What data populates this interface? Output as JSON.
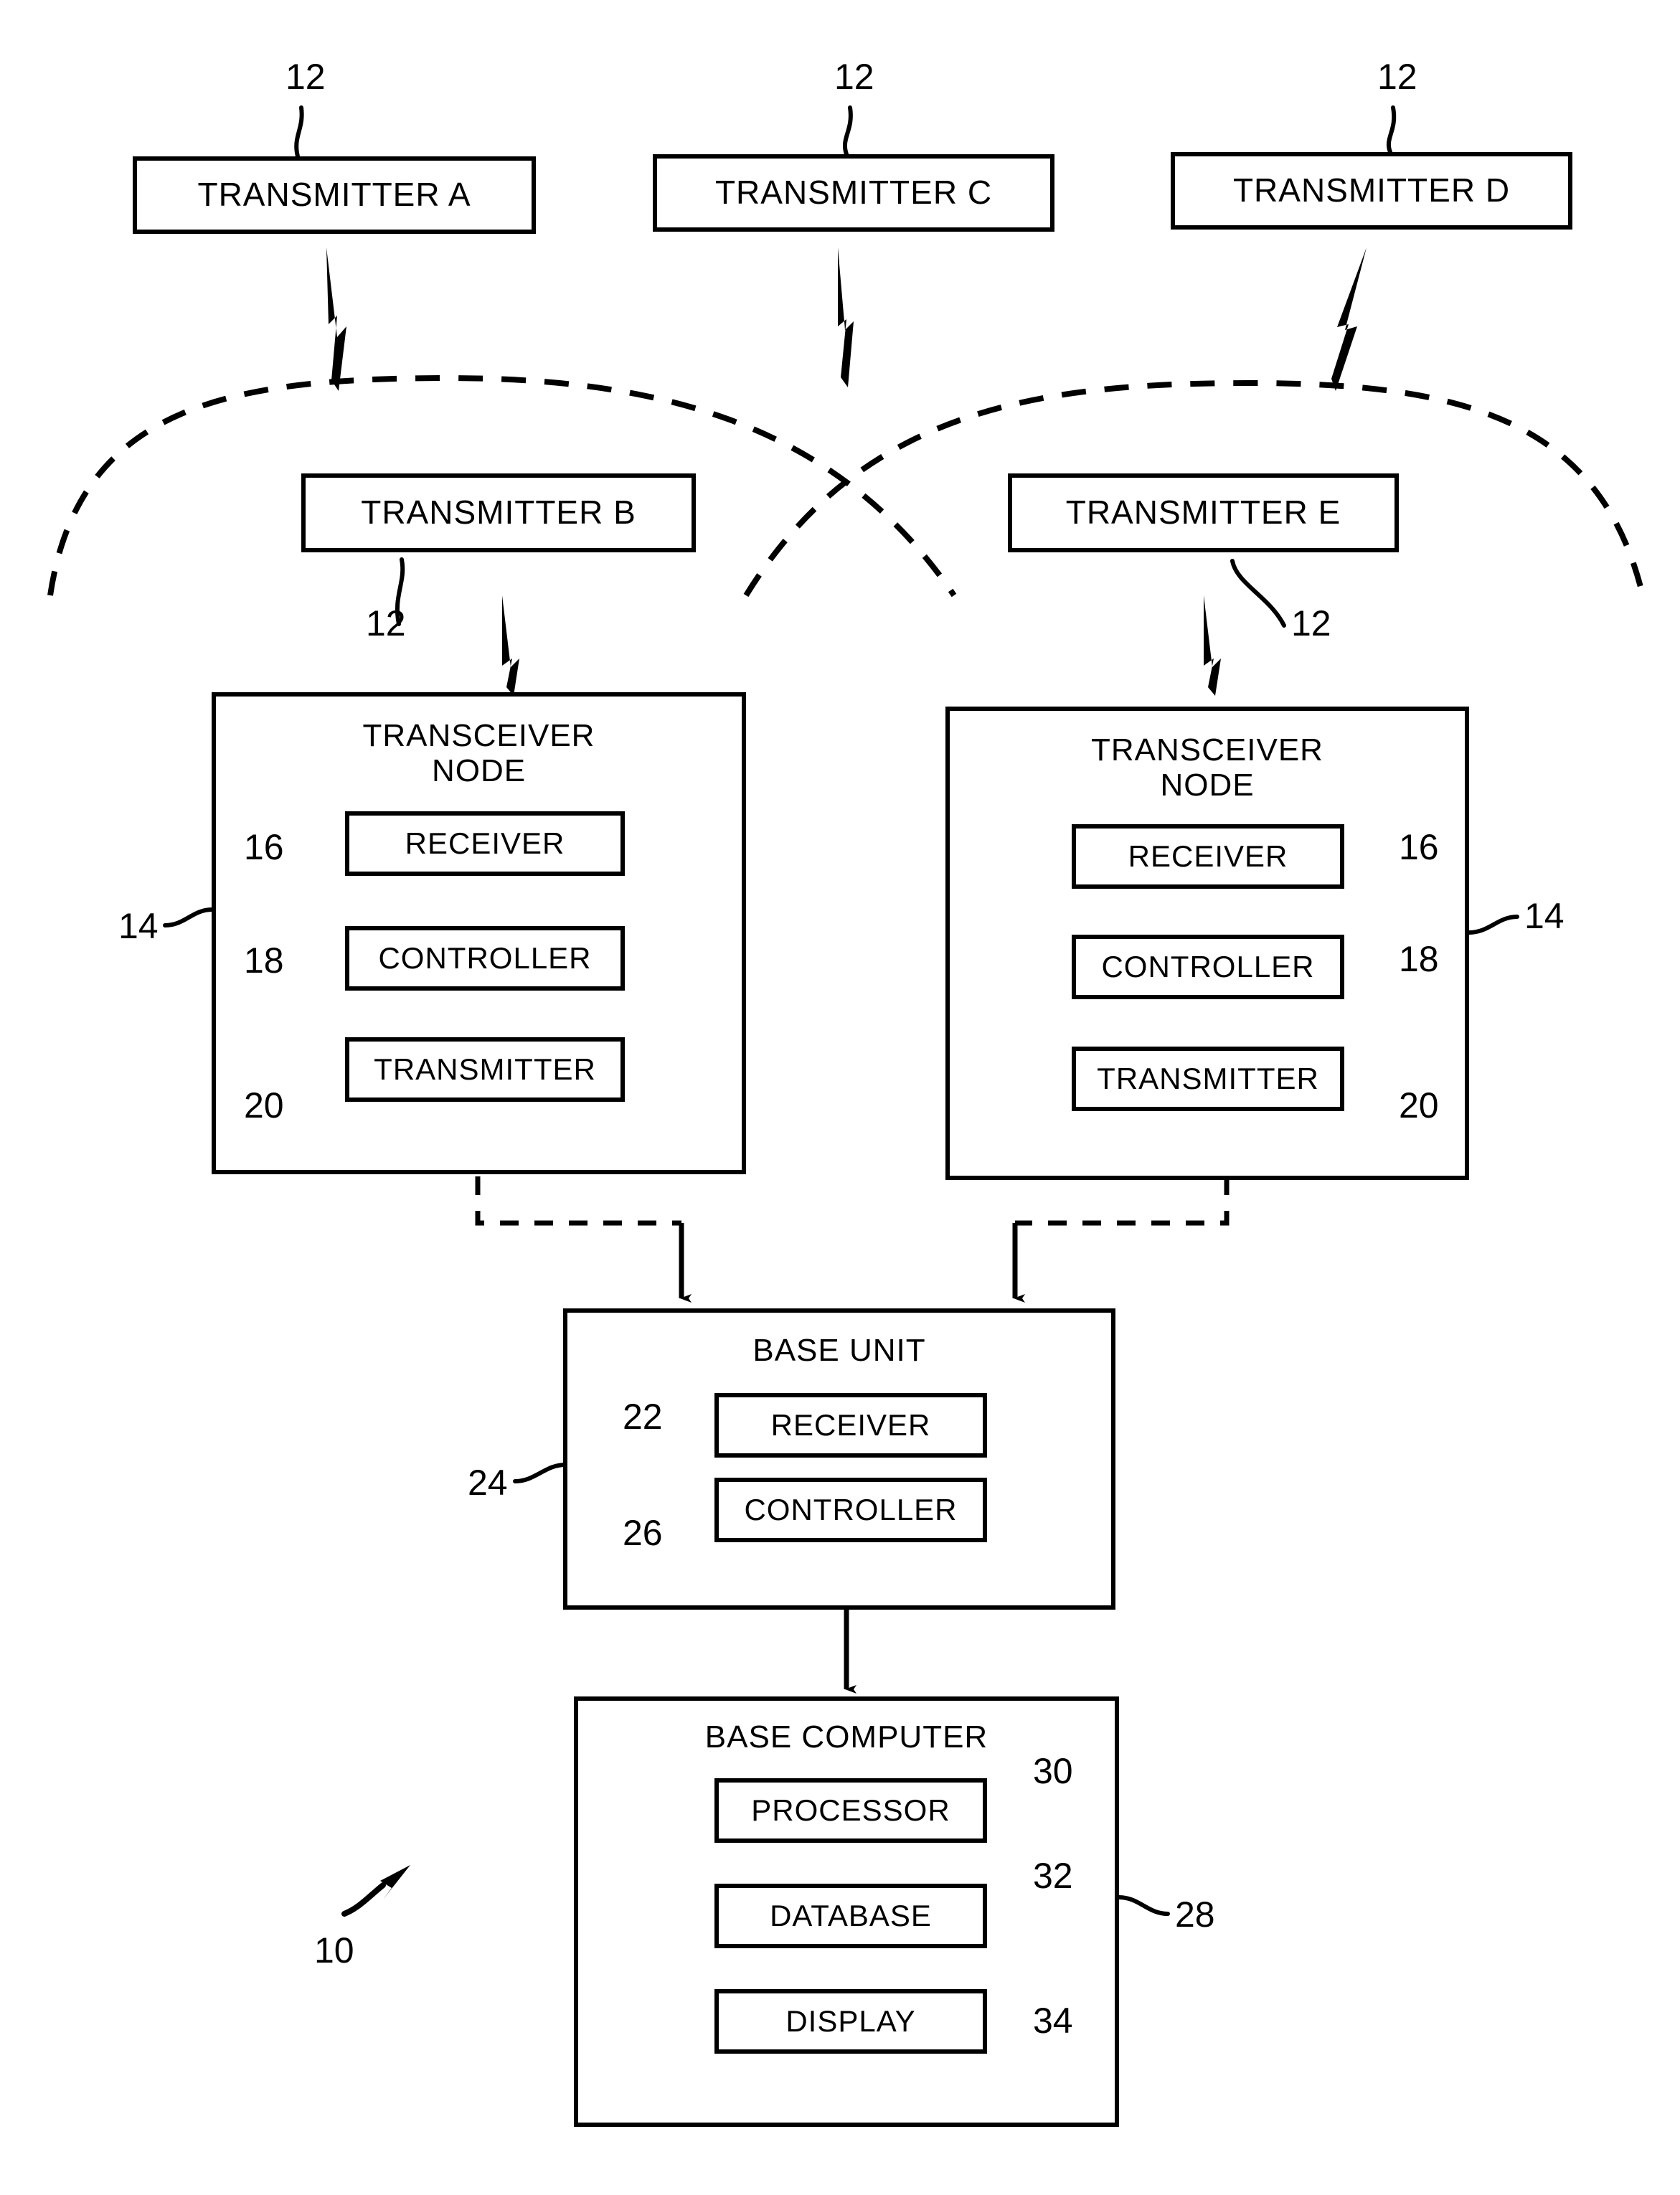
{
  "figure": {
    "name": "wireless-transmitter-network-block-diagram",
    "system_ref": "10"
  },
  "top_transmitters": [
    {
      "label": "TRANSMITTER A",
      "ref": "12"
    },
    {
      "label": "TRANSMITTER C",
      "ref": "12"
    },
    {
      "label": "TRANSMITTER D",
      "ref": "12"
    }
  ],
  "mid_transmitters": [
    {
      "label": "TRANSMITTER B",
      "ref": "12"
    },
    {
      "label": "TRANSMITTER E",
      "ref": "12"
    }
  ],
  "transceiver_nodes": [
    {
      "title_line1": "TRANSCEIVER",
      "title_line2": "NODE",
      "ref": "14",
      "components": [
        {
          "label": "RECEIVER",
          "ref": "16"
        },
        {
          "label": "CONTROLLER",
          "ref": "18"
        },
        {
          "label": "TRANSMITTER",
          "ref": "20"
        }
      ]
    },
    {
      "title_line1": "TRANSCEIVER",
      "title_line2": "NODE",
      "ref": "14",
      "components": [
        {
          "label": "RECEIVER",
          "ref": "16"
        },
        {
          "label": "CONTROLLER",
          "ref": "18"
        },
        {
          "label": "TRANSMITTER",
          "ref": "20"
        }
      ]
    }
  ],
  "base_unit": {
    "title": "BASE UNIT",
    "ref": "24",
    "components": [
      {
        "label": "RECEIVER",
        "ref": "22"
      },
      {
        "label": "CONTROLLER",
        "ref": "26"
      }
    ]
  },
  "base_computer": {
    "title": "BASE COMPUTER",
    "ref": "28",
    "components": [
      {
        "label": "PROCESSOR",
        "ref": "30"
      },
      {
        "label": "DATABASE",
        "ref": "32"
      },
      {
        "label": "DISPLAY",
        "ref": "34"
      }
    ]
  },
  "colors": {
    "ink": "#000000",
    "paper": "#ffffff"
  }
}
